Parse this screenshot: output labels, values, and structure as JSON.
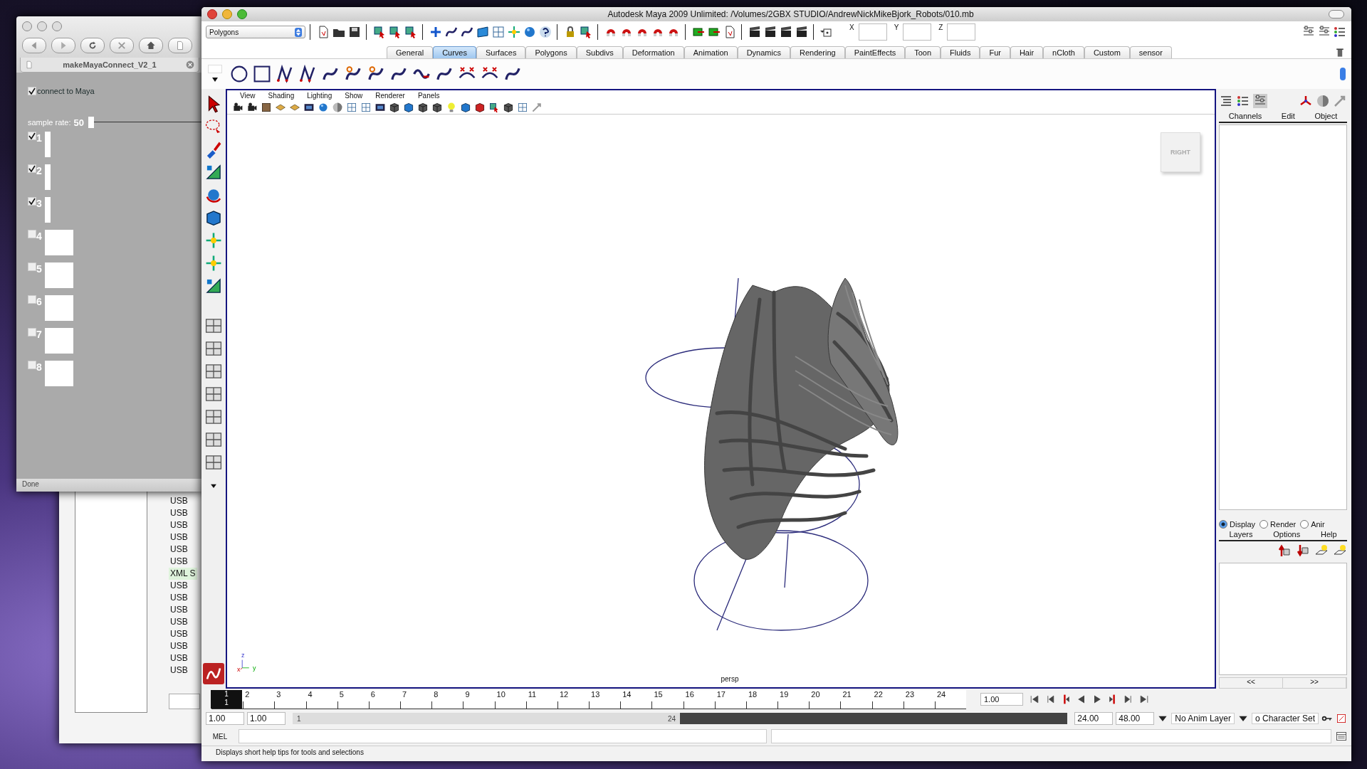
{
  "background_window": {
    "list_items": [
      {
        "label": "USB",
        "selected": false
      },
      {
        "label": "USB",
        "selected": false
      },
      {
        "label": "USB",
        "selected": false
      },
      {
        "label": "USB",
        "selected": false
      },
      {
        "label": "USB",
        "selected": false
      },
      {
        "label": "USB",
        "selected": false
      },
      {
        "label": "XML S",
        "selected": true
      },
      {
        "label": "USB",
        "selected": false
      },
      {
        "label": "USB",
        "selected": false
      },
      {
        "label": "USB",
        "selected": false
      },
      {
        "label": "USB",
        "selected": false
      },
      {
        "label": "USB",
        "selected": false
      },
      {
        "label": "USB",
        "selected": false
      },
      {
        "label": "USB",
        "selected": false
      },
      {
        "label": "USB",
        "selected": false
      }
    ]
  },
  "browser": {
    "tab_title": "makeMayaConnect_V2_1",
    "connect": {
      "label": "connect to Maya",
      "checked": true
    },
    "sample_rate": {
      "label": "sample rate:",
      "value": "50",
      "level": 0
    },
    "channels": [
      {
        "label": "1",
        "checked": true
      },
      {
        "label": "2",
        "checked": true
      },
      {
        "label": "3",
        "checked": true
      },
      {
        "label": "4",
        "checked": false
      },
      {
        "label": "5",
        "checked": false
      },
      {
        "label": "6",
        "checked": false
      },
      {
        "label": "7",
        "checked": false
      },
      {
        "label": "8",
        "checked": false
      }
    ],
    "status": "Done"
  },
  "maya": {
    "title": "Autodesk Maya 2009 Unlimited: /Volumes/2GBX STUDIO/AndrewNickMikeBjork_Robots/010.mb",
    "mode_menu": "Polygons",
    "coord_fields": [
      {
        "label": "X"
      },
      {
        "label": "Y"
      },
      {
        "label": "Z"
      }
    ],
    "shelf_tabs": [
      {
        "label": "General",
        "selected": false
      },
      {
        "label": "Curves",
        "selected": true
      },
      {
        "label": "Surfaces",
        "selected": false
      },
      {
        "label": "Polygons",
        "selected": false
      },
      {
        "label": "Subdivs",
        "selected": false
      },
      {
        "label": "Deformation",
        "selected": false
      },
      {
        "label": "Animation",
        "selected": false
      },
      {
        "label": "Dynamics",
        "selected": false
      },
      {
        "label": "Rendering",
        "selected": false
      },
      {
        "label": "PaintEffects",
        "selected": false
      },
      {
        "label": "Toon",
        "selected": false
      },
      {
        "label": "Fluids",
        "selected": false
      },
      {
        "label": "Fur",
        "selected": false
      },
      {
        "label": "Hair",
        "selected": false
      },
      {
        "label": "nCloth",
        "selected": false
      },
      {
        "label": "Custom",
        "selected": false
      },
      {
        "label": "sensor",
        "selected": false
      }
    ],
    "panel_menus": [
      "View",
      "Shading",
      "Lighting",
      "Show",
      "Renderer",
      "Panels"
    ],
    "view_cube": "RIGHT",
    "camera": "persp",
    "axis_labels": {
      "z": "z",
      "x": "x",
      "y": "y"
    },
    "channel_box": {
      "menus": [
        "Channels",
        "Edit",
        "Object"
      ]
    },
    "layers": {
      "radios": [
        {
          "label": "Display",
          "selected": true
        },
        {
          "label": "Render",
          "selected": false
        },
        {
          "label": "Anir",
          "selected": false
        }
      ],
      "menus": [
        "Layers",
        "Options",
        "Help"
      ],
      "nav": [
        "<<",
        ">>"
      ]
    },
    "timeline": {
      "ticks": [
        {
          "label": "1",
          "selected": true
        },
        {
          "label": "2",
          "selected": false
        },
        {
          "label": "3",
          "selected": false
        },
        {
          "label": "4",
          "selected": false
        },
        {
          "label": "5",
          "selected": false
        },
        {
          "label": "6",
          "selected": false
        },
        {
          "label": "7",
          "selected": false
        },
        {
          "label": "8",
          "selected": false
        },
        {
          "label": "9",
          "selected": false
        },
        {
          "label": "10",
          "selected": false
        },
        {
          "label": "11",
          "selected": false
        },
        {
          "label": "12",
          "selected": false
        },
        {
          "label": "13",
          "selected": false
        },
        {
          "label": "14",
          "selected": false
        },
        {
          "label": "15",
          "selected": false
        },
        {
          "label": "16",
          "selected": false
        },
        {
          "label": "17",
          "selected": false
        },
        {
          "label": "18",
          "selected": false
        },
        {
          "label": "19",
          "selected": false
        },
        {
          "label": "20",
          "selected": false
        },
        {
          "label": "21",
          "selected": false
        },
        {
          "label": "22",
          "selected": false
        },
        {
          "label": "23",
          "selected": false
        },
        {
          "label": "24",
          "selected": false
        }
      ],
      "current_below": "1",
      "current_field": "1.00"
    },
    "range": {
      "start": "1.00",
      "inner_start": "1.00",
      "handle_start": "1",
      "handle_end": "24",
      "level": 0.5,
      "inner_end": "24.00",
      "end": "48.00"
    },
    "anim_layer": "No Anim Layer",
    "character_set": "o Character Set",
    "mel_label": "MEL",
    "help_line": "Displays short help tips for tools and selections"
  }
}
